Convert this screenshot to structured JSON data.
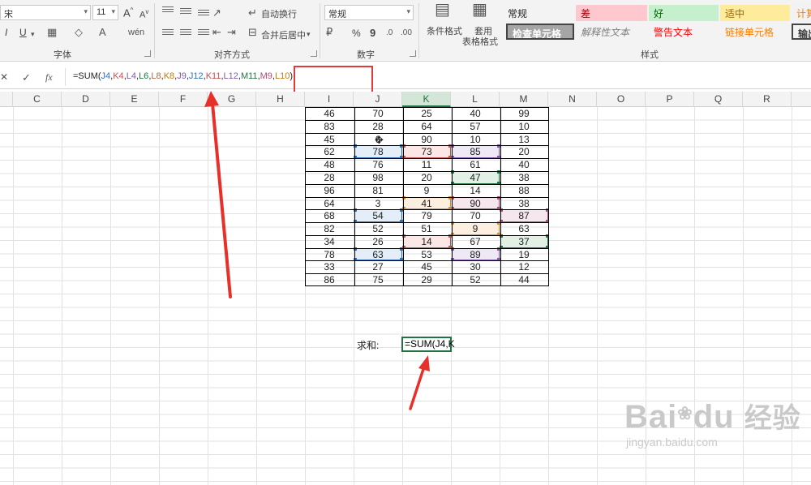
{
  "ribbon": {
    "font_name": "宋",
    "font_size": "11",
    "grow_font": "A",
    "shrink_font": "A",
    "bold": "I",
    "underline": "U",
    "font_group_label": "字体",
    "wrap_text_label": "自动换行",
    "merge_center_label": "合并后居中",
    "alignment_group_label": "对齐方式",
    "number_format": "常规",
    "percent": "%",
    "comma": "9",
    "number_group_label": "数字",
    "conditional_format_label": "条件格式",
    "table_format_label_1": "套用",
    "table_format_label_2": "表格格式",
    "styles_group_label": "样式",
    "styles": [
      {
        "label": "常规",
        "bg": "#f3f3f3",
        "color": "#222"
      },
      {
        "label": "差",
        "bg": "#ffc7ce",
        "color": "#9c0006"
      },
      {
        "label": "好",
        "bg": "#c6efce",
        "color": "#006100"
      },
      {
        "label": "适中",
        "bg": "#ffeb9c",
        "color": "#9c6500"
      },
      {
        "label": "计算",
        "bg": "#f2f2f2",
        "color": "#fa7d00"
      },
      {
        "label": "检查单元格",
        "bg": "#a5a5a5",
        "color": "#ffffff"
      },
      {
        "label": "解释性文本",
        "bg": "#f3f3f3",
        "color": "#7f7f7f"
      },
      {
        "label": "警告文本",
        "bg": "#f3f3f3",
        "color": "#ff0000"
      },
      {
        "label": "链接单元格",
        "bg": "#f3f3f3",
        "color": "#fa7d00"
      },
      {
        "label": "输出",
        "bg": "#f2f2f2",
        "color": "#3f3f3f"
      }
    ]
  },
  "formula_bar": {
    "cancel": "✕",
    "enter": "✓",
    "fx": "fx",
    "tokens": [
      {
        "t": "=SUM(",
        "c": "#222"
      },
      {
        "t": "J4",
        "c": "#2f6fb8"
      },
      {
        "t": ",",
        "c": "#222"
      },
      {
        "t": "K4",
        "c": "#c0504d"
      },
      {
        "t": ",",
        "c": "#222"
      },
      {
        "t": "L4",
        "c": "#7d5ba6"
      },
      {
        "t": ",",
        "c": "#222"
      },
      {
        "t": "L6",
        "c": "#217346"
      },
      {
        "t": ",",
        "c": "#222"
      },
      {
        "t": "L8",
        "c": "#b0693a"
      },
      {
        "t": ",",
        "c": "#222"
      },
      {
        "t": "K8",
        "c": "#c07a14"
      },
      {
        "t": ",",
        "c": "#222"
      },
      {
        "t": "J9",
        "c": "#7d5ba6"
      },
      {
        "t": ",",
        "c": "#222"
      },
      {
        "t": "J12",
        "c": "#2f6fb8"
      },
      {
        "t": ",",
        "c": "#222"
      },
      {
        "t": "K11",
        "c": "#c0504d"
      },
      {
        "t": ",",
        "c": "#222"
      },
      {
        "t": "L12",
        "c": "#7d5ba6"
      },
      {
        "t": ",",
        "c": "#222"
      },
      {
        "t": "M11",
        "c": "#217346"
      },
      {
        "t": ",",
        "c": "#222"
      },
      {
        "t": "M9",
        "c": "#b04a7a"
      },
      {
        "t": ",",
        "c": "#222"
      },
      {
        "t": "L10",
        "c": "#c07a14"
      },
      {
        "t": ")",
        "c": "#222"
      }
    ]
  },
  "columns": [
    "C",
    "D",
    "E",
    "F",
    "G",
    "H",
    "I",
    "J",
    "K",
    "L",
    "M",
    "N",
    "O",
    "P",
    "Q",
    "R"
  ],
  "table": {
    "rows": [
      [
        "46",
        "70",
        "25",
        "40",
        "99"
      ],
      [
        "83",
        "28",
        "64",
        "57",
        "10"
      ],
      [
        "45",
        "6",
        "90",
        "10",
        "13"
      ],
      [
        "62",
        "78",
        "73",
        "85",
        "20"
      ],
      [
        "48",
        "76",
        "11",
        "61",
        "40"
      ],
      [
        "28",
        "98",
        "20",
        "47",
        "38"
      ],
      [
        "96",
        "81",
        "9",
        "14",
        "88"
      ],
      [
        "64",
        "3",
        "41",
        "90",
        "38"
      ],
      [
        "68",
        "54",
        "79",
        "70",
        "87"
      ],
      [
        "82",
        "52",
        "51",
        "9",
        "63"
      ],
      [
        "34",
        "26",
        "14",
        "67",
        "37"
      ],
      [
        "78",
        "63",
        "53",
        "89",
        "19"
      ],
      [
        "33",
        "27",
        "45",
        "30",
        "12"
      ],
      [
        "86",
        "75",
        "29",
        "52",
        "44"
      ]
    ]
  },
  "highlights": [
    {
      "row": 3,
      "col": 1,
      "color": "#2f6fb8",
      "fill": "#e4eef8"
    },
    {
      "row": 3,
      "col": 2,
      "color": "#c0504d",
      "fill": "#fbe7e6"
    },
    {
      "row": 3,
      "col": 3,
      "color": "#7d5ba6",
      "fill": "#efe9f6"
    },
    {
      "row": 5,
      "col": 3,
      "color": "#217346",
      "fill": "#e2f0e6"
    },
    {
      "row": 7,
      "col": 3,
      "color": "#b04a7a",
      "fill": "#f6e6ee"
    },
    {
      "row": 7,
      "col": 2,
      "color": "#e08a2a",
      "fill": "#fcefe0"
    },
    {
      "row": 8,
      "col": 1,
      "color": "#2f6fb8",
      "fill": "#e4eef8"
    },
    {
      "row": 8,
      "col": 4,
      "color": "#b04a7a",
      "fill": "#f6e6ee"
    },
    {
      "row": 9,
      "col": 3,
      "color": "#e08a2a",
      "fill": "#fcefe0"
    },
    {
      "row": 10,
      "col": 2,
      "color": "#c0504d",
      "fill": "#fbe7e6"
    },
    {
      "row": 10,
      "col": 4,
      "color": "#217346",
      "fill": "#e2f0e6"
    },
    {
      "row": 11,
      "col": 1,
      "color": "#2f6fb8",
      "fill": "#e4eef8"
    },
    {
      "row": 11,
      "col": 3,
      "color": "#7d5ba6",
      "fill": "#efe9f6"
    }
  ],
  "sum": {
    "label": "求和:",
    "cell_text": "=SUM(J4,K"
  },
  "watermark": {
    "brand": "Bai",
    "brand2": "du",
    "brand_cn": "经验",
    "url": "jingyan.baidu.com"
  }
}
